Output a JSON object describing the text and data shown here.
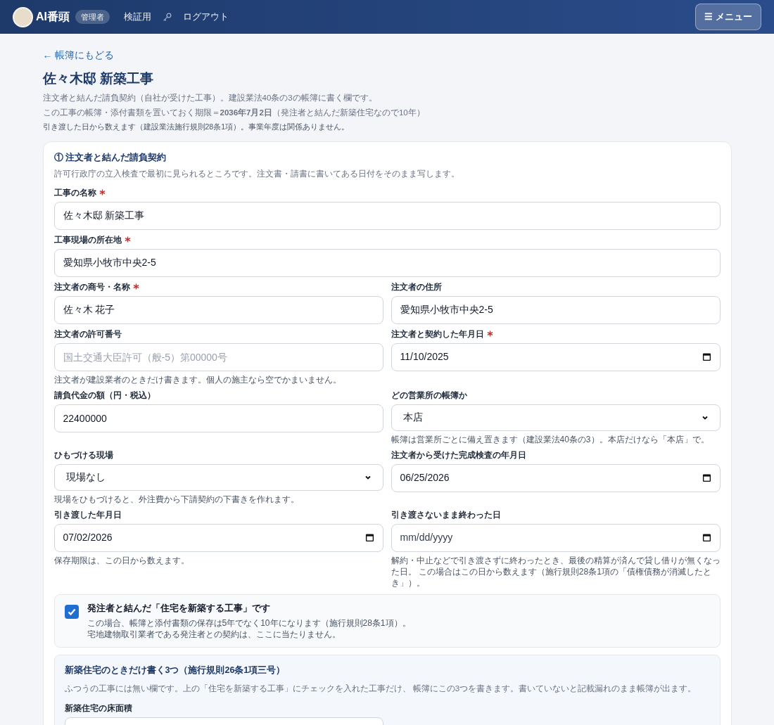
{
  "header": {
    "app_name": "AI番頭",
    "role_badge": "管理者",
    "nav_links": [
      "検証用",
      "ログアウト"
    ],
    "menu_button": {
      "icon": "☰",
      "label": "メニュー"
    }
  },
  "back_link": "← 帳簿にもどる",
  "page_title": "佐々木邸 新築工事",
  "intro": [
    "注文者と結んだ請負契約（自社が受けた工事）。建設業法40条の3の帳簿に書く欄です。",
    "この工事の帳簿・添付書類を置いておく期限＝**2036年7月2日**（発注者と結んだ新築住宅なので10年）"
  ],
  "note": "引き渡した日から数えます（建設業法施行規則28条1項）。事業年度は関係ありません。",
  "section": {
    "title": "① 注文者と結んだ請負契約",
    "description": "許可行政庁の立入検査で最初に見られるところです。注文書・請書に書いてある日付をそのまま写します。",
    "rows": [
      [
        {
          "label": "工事の名称",
          "required": true,
          "kind": "text",
          "value": "佐々木邸 新築工事"
        }
      ],
      [
        {
          "label": "工事現場の所在地",
          "required": true,
          "kind": "text",
          "value": "愛知県小牧市中央2-5"
        }
      ],
      [
        {
          "label": "注文者の商号・名称",
          "required": true,
          "kind": "text",
          "value": "佐々木 花子"
        },
        {
          "label": "注文者の住所",
          "required": false,
          "kind": "text",
          "value": "愛知県小牧市中央2-5"
        }
      ],
      [
        {
          "label": "注文者の許可番号",
          "required": false,
          "kind": "text",
          "placeholder": "国土交通大臣許可（般-5）第00000号",
          "help": "注文者が建設業者のときだけ書きます。個人の施主なら空でかまいません。"
        },
        {
          "label": "注文者と契約した年月日",
          "required": true,
          "kind": "date",
          "value": "11/10/2025"
        }
      ],
      [
        {
          "label": "請負代金の額（円・税込）",
          "required": false,
          "kind": "text",
          "value": "22400000"
        },
        {
          "label": "どの営業所の帳簿か",
          "required": false,
          "kind": "select",
          "value": "本店",
          "help": "帳簿は営業所ごとに備え置きます（建設業法40条の3）。本店だけなら「本店」で。"
        }
      ],
      [
        {
          "label": "ひもづける現場",
          "required": false,
          "kind": "select",
          "value": "現場なし",
          "help": "現場をひもづけると、外注費から下請契約の下書きを作れます。"
        },
        {
          "label": "注文者から受けた完成検査の年月日",
          "required": false,
          "kind": "date",
          "value": "06/25/2026"
        }
      ],
      [
        {
          "label": "引き渡した年月日",
          "required": false,
          "kind": "date",
          "value": "07/02/2026",
          "help": "保存期限は、この日から数えます。"
        },
        {
          "label": "引き渡さないまま終わった日",
          "required": false,
          "kind": "date",
          "placeholder": "mm/dd/yyyy",
          "help": "解約・中止などで引き渡さずに終わったとき、最後の精算が済んで貸し借りが無くなった日。 この場合はこの日から数えます（施行規則28条1項の「債権債務が消滅したとき」）。"
        }
      ]
    ],
    "checkbox": {
      "label": "発注者と結んだ「住宅を新築する工事」です",
      "checked": true,
      "notes": [
        "この場合、帳簿と添付書類の保存は5年でなく10年になります（施行規則28条1項）。",
        "宅地建物取引業者である発注者との契約は、ここに当たりません。"
      ]
    },
    "subsection": {
      "title": "新築住宅のときだけ書く3つ（施行規則26条1項三号）",
      "description": "ふつうの工事には無い欄です。上の「住宅を新築する工事」にチェックを入れた工事だけ、 帳簿にこの3つを書きます。書いていないと記載漏れのまま帳簿が出ます。",
      "fields": [
        {
          "label": "新築住宅の床面積",
          "kind": "text"
        }
      ]
    }
  }
}
